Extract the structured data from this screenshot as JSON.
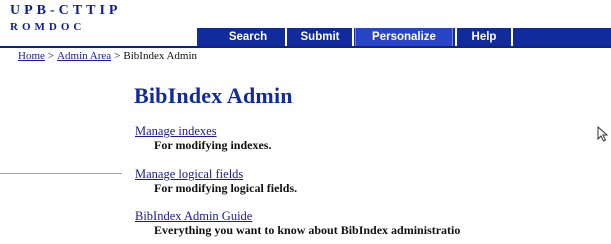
{
  "logo": {
    "line1": "UPB-CTTIP",
    "line2": "ROMDOC"
  },
  "nav": {
    "tabs": [
      {
        "label": "Search"
      },
      {
        "label": "Submit"
      },
      {
        "label": "Personalize"
      },
      {
        "label": "Help"
      }
    ]
  },
  "breadcrumb": {
    "items": [
      "Home",
      "Admin Area",
      "BibIndex Admin"
    ],
    "separator": ">"
  },
  "main": {
    "title": "BibIndex Admin",
    "items": [
      {
        "link": "Manage indexes",
        "description": "For modifying indexes."
      },
      {
        "link": "Manage logical fields",
        "description": "For modifying logical fields."
      },
      {
        "link": "BibIndex Admin Guide",
        "description": "Everything you want to know about BibIndex administratio"
      }
    ]
  },
  "colors": {
    "brand_blue": "#112a9c",
    "tab_highlight": "#2945c7",
    "link": "#1a1a9a"
  },
  "icons": {
    "cursor": "mouse-pointer-icon"
  }
}
